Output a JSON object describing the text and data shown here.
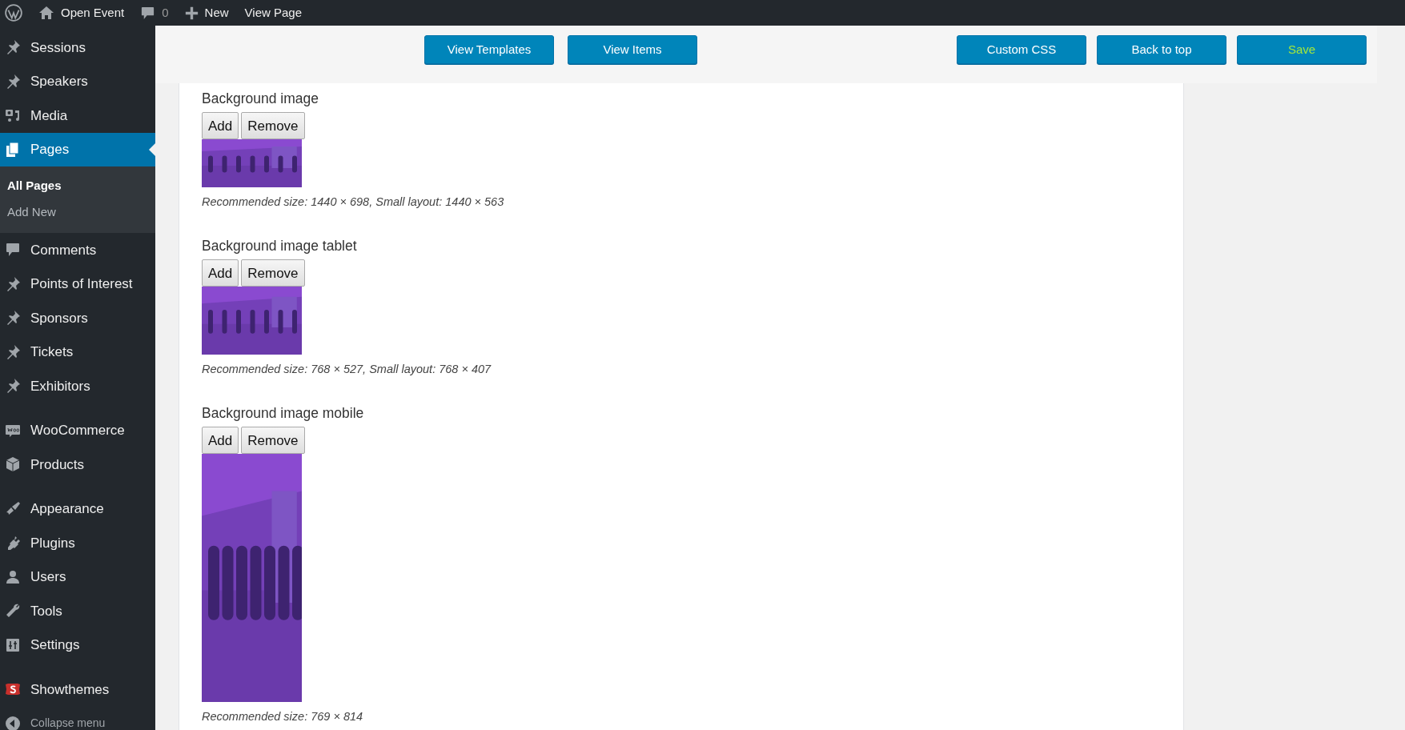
{
  "admin_bar": {
    "site": "Open Event",
    "comments": "0",
    "new": "New",
    "view": "View Page"
  },
  "sidebar": {
    "groups": [
      [
        {
          "label": "Sessions",
          "kind": "pin",
          "selected": false
        },
        {
          "label": "Speakers",
          "kind": "pin",
          "selected": false
        },
        {
          "label": "Media",
          "kind": "media",
          "selected": false
        },
        {
          "label": "Pages",
          "kind": "pages",
          "selected": true,
          "children": [
            {
              "label": "All Pages",
              "selected": true
            },
            {
              "label": "Add New",
              "selected": false
            }
          ]
        },
        {
          "label": "Comments",
          "kind": "comment",
          "selected": false
        },
        {
          "label": "Points of Interest",
          "kind": "pin",
          "selected": false
        },
        {
          "label": "Sponsors",
          "kind": "pin",
          "selected": false
        },
        {
          "label": "Tickets",
          "kind": "pin",
          "selected": false
        },
        {
          "label": "Exhibitors",
          "kind": "pin",
          "selected": false
        }
      ],
      [
        {
          "label": "WooCommerce",
          "kind": "woo",
          "selected": false
        },
        {
          "label": "Products",
          "kind": "box",
          "selected": false
        }
      ],
      [
        {
          "label": "Appearance",
          "kind": "brush",
          "selected": false
        },
        {
          "label": "Plugins",
          "kind": "plug",
          "selected": false
        },
        {
          "label": "Users",
          "kind": "user",
          "selected": false
        },
        {
          "label": "Tools",
          "kind": "wrench",
          "selected": false
        },
        {
          "label": "Settings",
          "kind": "settings",
          "selected": false
        }
      ],
      [
        {
          "label": "Showthemes",
          "kind": "showthemes",
          "selected": false
        },
        {
          "label": "Collapse menu",
          "kind": "collapse",
          "selected": false
        }
      ]
    ]
  },
  "toolbar": {
    "left": [
      {
        "label": "View Templates",
        "highlight": false
      },
      {
        "label": "View Items",
        "highlight": false
      }
    ],
    "right": [
      {
        "label": "Custom CSS",
        "highlight": false
      },
      {
        "label": "Back to top",
        "highlight": false
      },
      {
        "label": "Save",
        "highlight": true
      }
    ]
  },
  "sections": [
    {
      "label": "Background image",
      "buttons": [
        "Add",
        "Remove"
      ],
      "kind": "picture",
      "caption": "Recommended size: 1440 × 698, Small layout: 1440 × 563"
    },
    {
      "label": "Background image tablet",
      "buttons": [
        "Add",
        "Remove"
      ],
      "kind": "picture",
      "caption": "Recommended size: 768 × 527, Small layout: 768 × 407"
    },
    {
      "label": "Background image mobile",
      "buttons": [
        "Add",
        "Remove"
      ],
      "kind": "picture",
      "caption": "Recommended size: 769 × 814"
    }
  ]
}
